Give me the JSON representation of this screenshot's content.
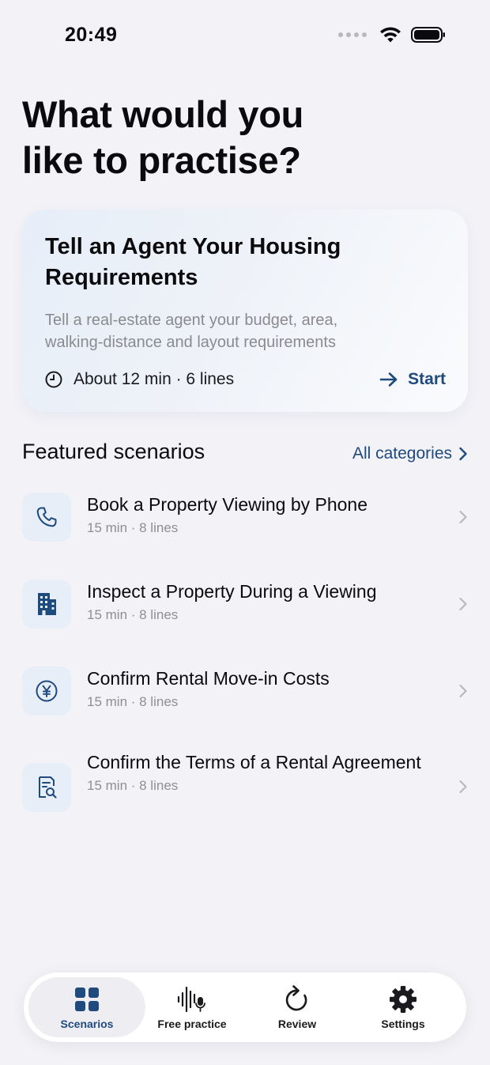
{
  "status_bar": {
    "time": "20:49"
  },
  "page": {
    "title": "What would you like to practise?"
  },
  "hero": {
    "title": "Tell an Agent Your Housing Requirements",
    "description": "Tell a real-estate agent your budget, area, walking-distance and layout requirements",
    "meta": "About 12 min · 6 lines",
    "start_label": "Start"
  },
  "featured": {
    "section_title": "Featured scenarios",
    "all_categories_label": "All categories",
    "items": [
      {
        "title": "Book a Property Viewing by Phone",
        "meta": "15 min · 8 lines",
        "icon": "phone-icon"
      },
      {
        "title": "Inspect a Property During a Viewing",
        "meta": "15 min · 8 lines",
        "icon": "building-icon"
      },
      {
        "title": "Confirm Rental Move-in Costs",
        "meta": "15 min · 8 lines",
        "icon": "yen-icon"
      },
      {
        "title": "Confirm the Terms of a Rental Agreement",
        "meta": "15 min · 8 lines",
        "icon": "document-search-icon"
      }
    ]
  },
  "tab_bar": {
    "tabs": [
      {
        "label": "Scenarios",
        "icon": "grid-icon",
        "active": true
      },
      {
        "label": "Free practice",
        "icon": "waveform-mic-icon",
        "active": false
      },
      {
        "label": "Review",
        "icon": "refresh-icon",
        "active": false
      },
      {
        "label": "Settings",
        "icon": "gear-icon",
        "active": false
      }
    ]
  },
  "colors": {
    "background": "#f2f2f7",
    "accent": "#1f4a7e",
    "secondary_text": "#8e8e93",
    "icon_tile": "#e7eef8"
  }
}
